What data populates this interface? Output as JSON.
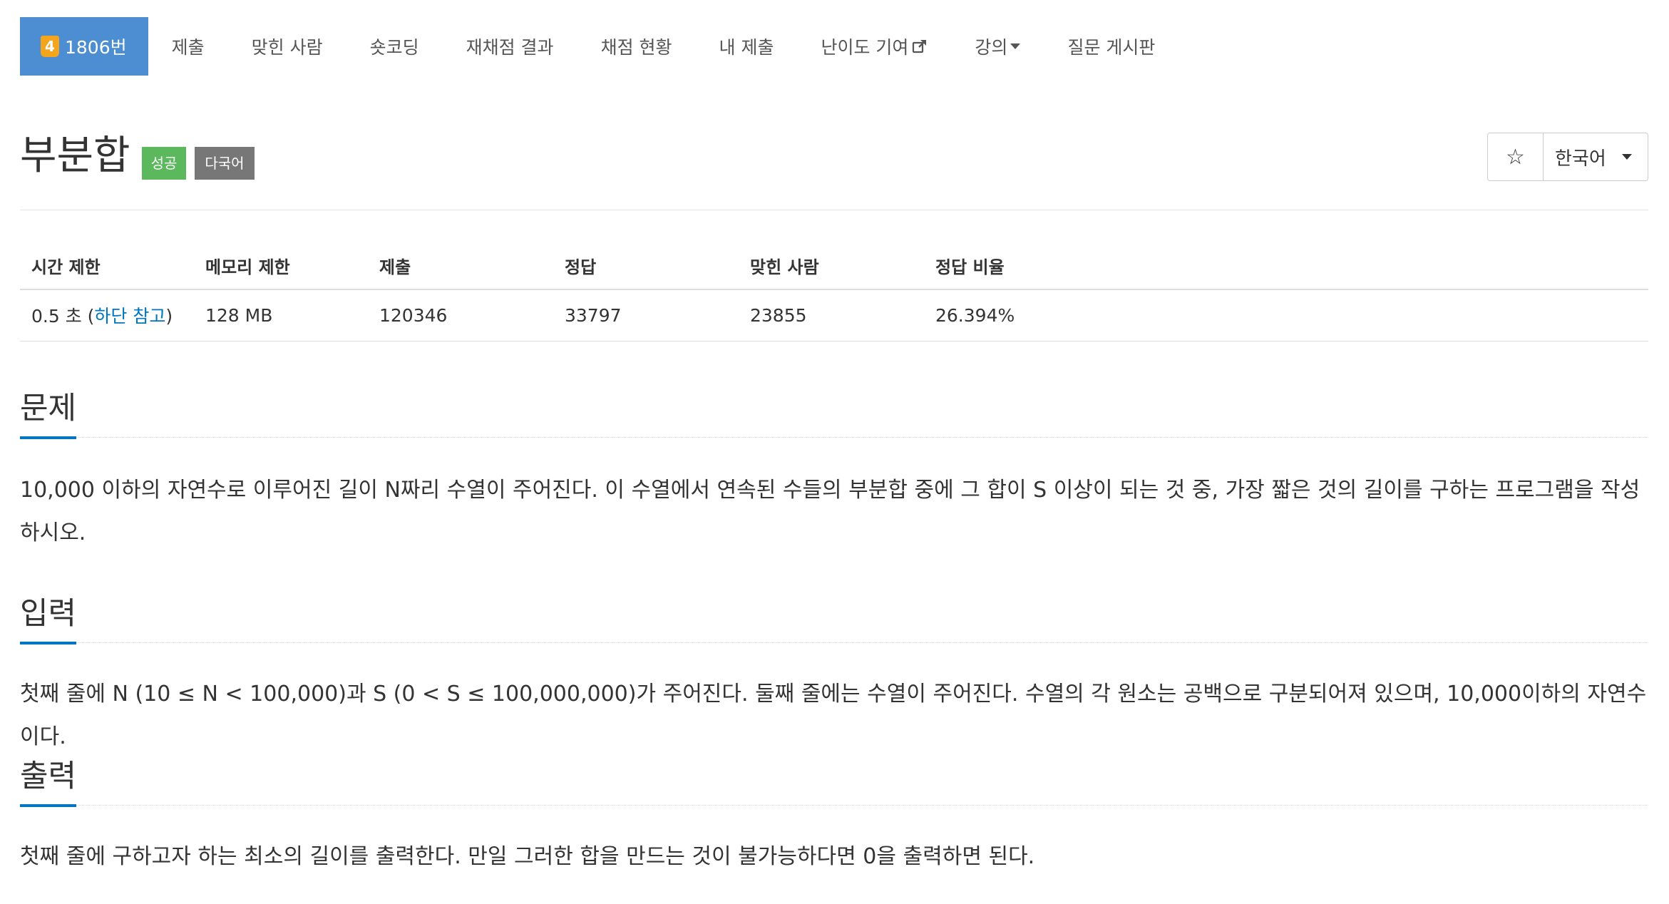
{
  "tabs": {
    "problem": {
      "tier": "4",
      "label": "1806번"
    },
    "items": [
      "제출",
      "맞힌 사람",
      "숏코딩",
      "재채점 결과",
      "채점 현황",
      "내 제출",
      "난이도 기여",
      "강의",
      "질문 게시판"
    ]
  },
  "title": {
    "text": "부분합",
    "badge_success": "성공",
    "badge_multilang": "다국어"
  },
  "toolbar": {
    "star_label": "☆",
    "language": "한국어"
  },
  "info": {
    "headers": [
      "시간 제한",
      "메모리 제한",
      "제출",
      "정답",
      "맞힌 사람",
      "정답 비율"
    ],
    "time_limit_value": "0.5 초 (",
    "time_limit_link": "하단 참고",
    "time_limit_close": ")",
    "memory": "128 MB",
    "submissions": "120346",
    "accepted": "33797",
    "solvers": "23855",
    "ratio": "26.394%"
  },
  "sections": {
    "problem": {
      "title": "문제",
      "body": "10,000 이하의 자연수로 이루어진 길이 N짜리 수열이 주어진다. 이 수열에서 연속된 수들의 부분합 중에 그 합이 S 이상이 되는 것 중, 가장 짧은 것의 길이를 구하는 프로그램을 작성하시오."
    },
    "input": {
      "title": "입력",
      "body": "첫째 줄에 N (10 ≤ N < 100,000)과 S (0 < S ≤ 100,000,000)가 주어진다. 둘째 줄에는 수열이 주어진다. 수열의 각 원소는 공백으로 구분되어져 있으며, 10,000이하의 자연수이다."
    },
    "output": {
      "title": "출력",
      "body": "첫째 줄에 구하고자 하는 최소의 길이를 출력한다. 만일 그러한 합을 만드는 것이 불가능하다면 0을 출력하면 된다."
    }
  },
  "colors": {
    "active_tab": "#4c8ed1",
    "tier_gold": "#f3a51d",
    "success": "#5cb85c",
    "multilang": "#777777",
    "link": "#0076c0"
  }
}
